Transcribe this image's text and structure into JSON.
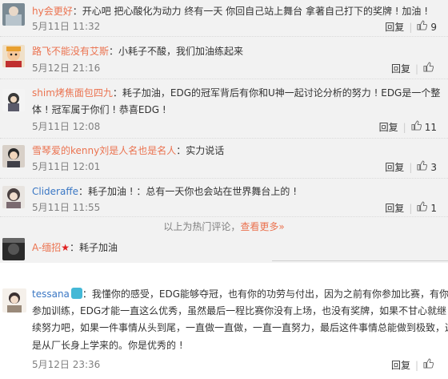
{
  "comments": [
    {
      "user": "hy会更好",
      "text": "：开心吧 把心酸化为动力 终有一天 你回自己站上舞台 拿著自己打下的奖牌 ! 加油 !",
      "time": "5月11日 11:32",
      "reply": "回复",
      "likes": "9"
    },
    {
      "user": "路飞不能没有艾斯",
      "text": "：小耗子不酸，我们加油练起来",
      "time": "5月12日 21:16",
      "reply": "回复",
      "likes": ""
    },
    {
      "user": "shim烤焦面包四九",
      "text_line1": "：耗子加油，EDG的冠军背后有你和U神一起讨论分析的努力 ! EDG是一个整",
      "text_line2": "体 ! 冠军属于你们 ! 恭喜EDG !",
      "time": "5月11日 12:08",
      "reply": "回复",
      "likes": "11"
    },
    {
      "user": "雪琴爱的kenny刘是人名也是名人",
      "text": "：实力说话",
      "time": "5月11日 12:01",
      "reply": "回复",
      "likes": "3"
    },
    {
      "user": "Clideraffe",
      "text": "：耗子加油 ! ：总有一天你也会站在世界舞台上的 !",
      "time": "5月11日 11:55",
      "reply": "回复",
      "likes": "1"
    }
  ],
  "hot_more": {
    "prefix": "以上为热门评论，",
    "link": "查看更多»"
  },
  "partial_comment": {
    "user": "A-缅招",
    "text": "：耗子加油"
  },
  "main_comment": {
    "user": "tessana",
    "line1": "：我懂你的感受，EDG能够夺冠，也有你的功劳与付出，因为之前有你参加比赛，有你",
    "line2": "参加训练，EDG才能一直这么优秀，虽然最后一程比赛你没有上场，也没有奖牌，如果不甘心就继",
    "line3": "续努力吧，如果一件事情从头到尾，一直做一直做，一直一直努力，最后这件事情总能做到极致，这",
    "line4": "是从厂长身上学来的。你是优秀的 !",
    "time": "5月12日 23:36",
    "reply": "回复",
    "likes": ""
  },
  "colors": {
    "username": "#eb7350",
    "hot_bg": "#f2f2f2",
    "time": "#808080"
  }
}
